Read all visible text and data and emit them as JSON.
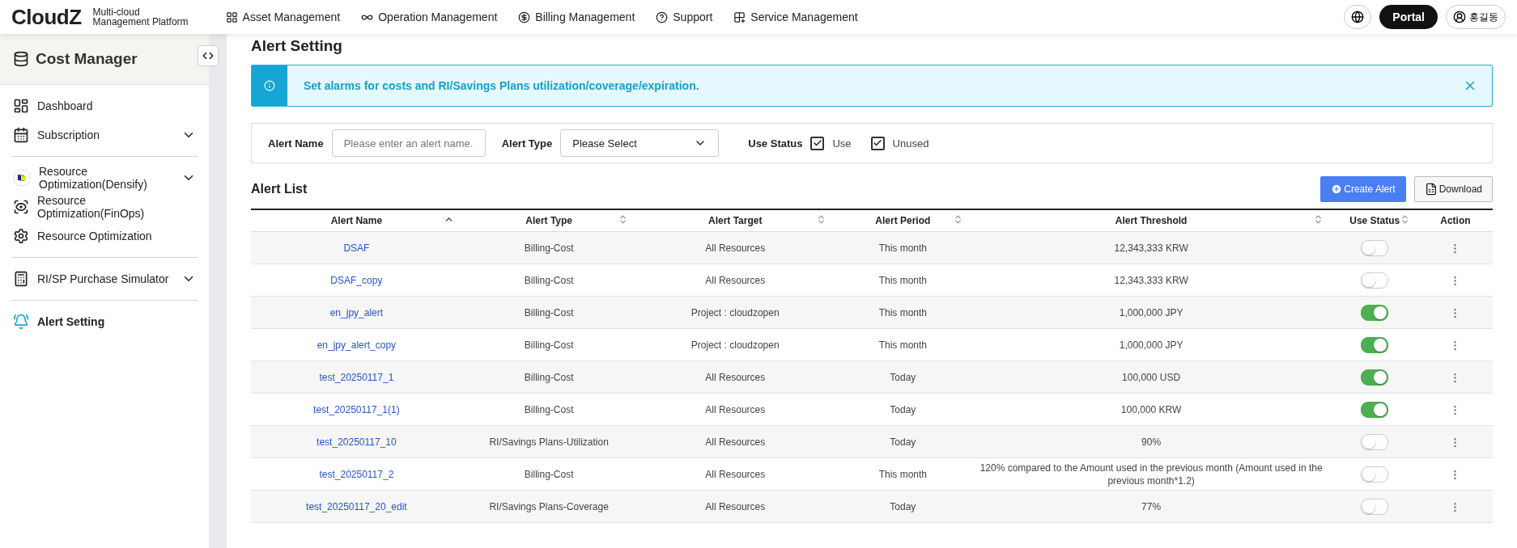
{
  "header": {
    "logo": "CloudZ",
    "tagline_1": "Multi-cloud",
    "tagline_2": "Management Platform",
    "nav": [
      {
        "label": "Asset Management"
      },
      {
        "label": "Operation Management"
      },
      {
        "label": "Billing Management"
      },
      {
        "label": "Support"
      },
      {
        "label": "Service Management"
      }
    ],
    "portal": "Portal",
    "user": "홍길동"
  },
  "sidebar": {
    "title": "Cost Manager",
    "groups": [
      [
        {
          "label": "Dashboard",
          "expandable": false,
          "selected": false
        },
        {
          "label": "Subscription",
          "expandable": true,
          "selected": false
        }
      ],
      [
        {
          "label": "Resource Optimization(Densify)",
          "expandable": true,
          "selected": false
        },
        {
          "label": "Resource Optimization(FinOps)",
          "expandable": false,
          "selected": false
        },
        {
          "label": "Resource Optimization",
          "expandable": false,
          "selected": false
        }
      ],
      [
        {
          "label": "RI/SP Purchase Simulator",
          "expandable": true,
          "selected": false
        }
      ],
      [
        {
          "label": "Alert Setting",
          "expandable": false,
          "selected": true
        }
      ]
    ]
  },
  "page_title": "Alert Setting",
  "banner": "Set alarms for costs and RI/Savings Plans utilization/coverage/expiration.",
  "filters": {
    "name_label": "Alert Name",
    "name_placeholder": "Please enter an alert name.",
    "type_label": "Alert Type",
    "type_value": "Please Select",
    "status_label": "Use Status",
    "status_options": [
      {
        "label": "Use",
        "checked": true
      },
      {
        "label": "Unused",
        "checked": true
      }
    ]
  },
  "list_title": "Alert List",
  "create_button": "Create Alert",
  "download_button": "Download",
  "table": {
    "columns": [
      {
        "label": "Alert Name",
        "sorted": true
      },
      {
        "label": "Alert Type",
        "sorted": false
      },
      {
        "label": "Alert Target",
        "sorted": false
      },
      {
        "label": "Alert Period",
        "sorted": false
      },
      {
        "label": "Alert Threshold",
        "sorted": false
      },
      {
        "label": "Use Status",
        "sorted": false
      },
      {
        "label": "Action"
      }
    ],
    "rows": [
      {
        "name": "DSAF",
        "type": "Billing-Cost",
        "target": "All Resources",
        "period": "This month",
        "threshold": "12,343,333 KRW",
        "on": false
      },
      {
        "name": "DSAF_copy",
        "type": "Billing-Cost",
        "target": "All Resources",
        "period": "This month",
        "threshold": "12,343,333 KRW",
        "on": false
      },
      {
        "name": "en_jpy_alert",
        "type": "Billing-Cost",
        "target": "Project : cloudzopen",
        "period": "This month",
        "threshold": "1,000,000 JPY",
        "on": true
      },
      {
        "name": "en_jpy_alert_copy",
        "type": "Billing-Cost",
        "target": "Project : cloudzopen",
        "period": "This month",
        "threshold": "1,000,000 JPY",
        "on": true
      },
      {
        "name": "test_20250117_1",
        "type": "Billing-Cost",
        "target": "All Resources",
        "period": "Today",
        "threshold": "100,000 USD",
        "on": true
      },
      {
        "name": "test_20250117_1(1)",
        "type": "Billing-Cost",
        "target": "All Resources",
        "period": "Today",
        "threshold": "100,000 KRW",
        "on": true
      },
      {
        "name": "test_20250117_10",
        "type": "RI/Savings Plans-Utilization",
        "target": "All Resources",
        "period": "Today",
        "threshold": "90%",
        "on": false
      },
      {
        "name": "test_20250117_2",
        "type": "Billing-Cost",
        "target": "All Resources",
        "period": "This month",
        "threshold": "120% compared to the Amount used in the previous month (Amount used in the previous month*1.2)",
        "on": false
      },
      {
        "name": "test_20250117_20_edit",
        "type": "RI/Savings Plans-Coverage",
        "target": "All Resources",
        "period": "Today",
        "threshold": "77%",
        "on": false
      }
    ]
  }
}
